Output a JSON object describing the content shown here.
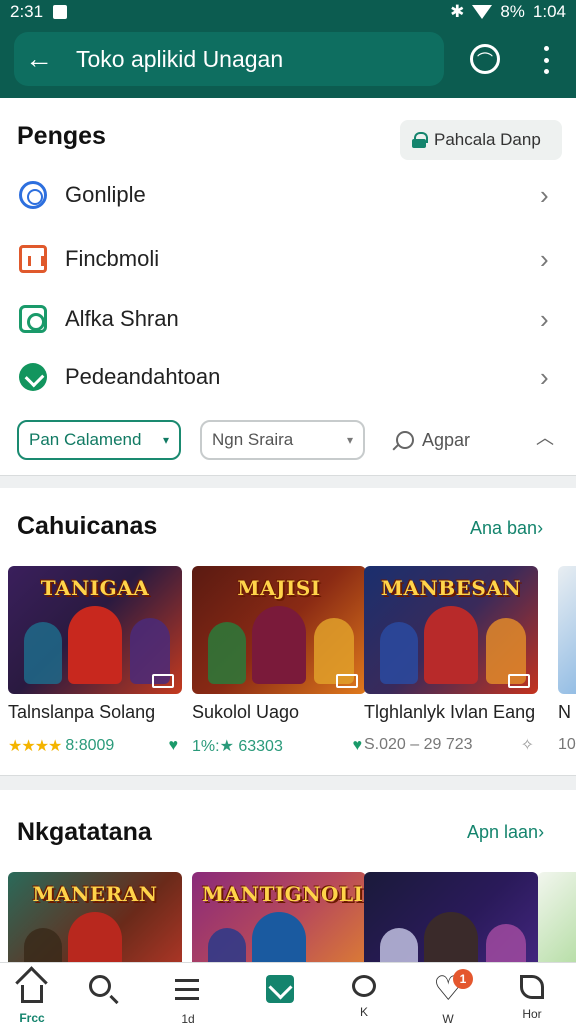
{
  "status_bar": {
    "time": "2:31",
    "battery": "8%",
    "clock": "1:04"
  },
  "app_bar": {
    "title": "Toko aplikid Unagan"
  },
  "card": {
    "heading": "Penges",
    "chip_label": "Pahcala Danp",
    "rows": [
      {
        "label": "Gonliple",
        "icon": "google-icon",
        "color": "#2d6fde"
      },
      {
        "label": "Fincbmoli",
        "icon": "finance-icon",
        "color": "#e0592c"
      },
      {
        "label": "Alfka Shran",
        "icon": "account-icon",
        "color": "#1a9a6a"
      },
      {
        "label": "Pedeandahtoan",
        "icon": "protect-icon",
        "color": "#12955e"
      }
    ],
    "filters": {
      "primary": "Pan Calamend",
      "secondary": "Ngn Sraira",
      "search": "Agpar"
    }
  },
  "section1": {
    "title": "Cahuicanas",
    "link": "Ana ban",
    "apps": [
      {
        "banner": "TANIGAA",
        "name": "Talnslanpa Solang",
        "rating": "8:8009",
        "stars": "★★★★",
        "colors": [
          "#3a1f5c",
          "#c53a1e"
        ]
      },
      {
        "banner": "MAJISI",
        "name": "Sukolol Uago",
        "rating": "1%:★ 63303",
        "stars": "",
        "colors": [
          "#5a1a12",
          "#e07a1c"
        ]
      },
      {
        "banner": "MANBESAN",
        "name": "Tlghlanlyk Ivlan Eang",
        "rating": "S.020 – 29 723",
        "stars": "",
        "colors": [
          "#1a2f6e",
          "#c4321e"
        ]
      },
      {
        "banner": "",
        "name": "N",
        "rating": "10",
        "stars": "",
        "colors": [
          "#e9eef2",
          "#3a8ad6"
        ]
      }
    ]
  },
  "section2": {
    "title": "Nkgatatana",
    "link": "Apn laan",
    "apps": [
      {
        "banner": "MANERAN",
        "colors": [
          "#2a6a5a",
          "#c23a2a"
        ]
      },
      {
        "banner": "MANTIGNOLI",
        "colors": [
          "#8a2a7a",
          "#e58a2a"
        ]
      },
      {
        "banner": "",
        "colors": [
          "#1a1a3a",
          "#4a2a8a"
        ]
      },
      {
        "banner": "",
        "colors": [
          "#f2f6ee",
          "#6abf4a"
        ]
      }
    ]
  },
  "bottom_nav": [
    {
      "icon": "home-icon",
      "label": "Frcc"
    },
    {
      "icon": "search-icon",
      "label": ""
    },
    {
      "icon": "list-icon",
      "label": "1d"
    },
    {
      "icon": "apps-icon",
      "label": ""
    },
    {
      "icon": "chat-icon",
      "label": "K"
    },
    {
      "icon": "heart-icon",
      "label": "W",
      "badge": "1"
    },
    {
      "icon": "leaf-icon",
      "label": "Hor"
    }
  ]
}
